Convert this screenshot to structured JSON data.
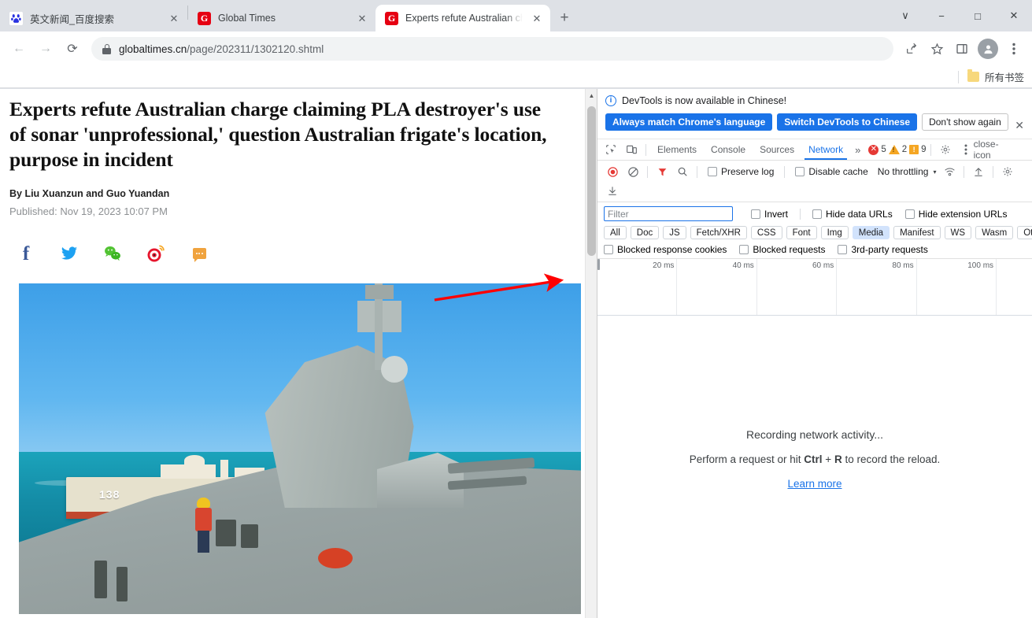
{
  "browser": {
    "tabs": [
      {
        "title": "英文新闻_百度搜索",
        "favicon": "baidu-icon",
        "active": false
      },
      {
        "title": "Global Times",
        "favicon": "globaltimes-icon",
        "active": false
      },
      {
        "title": "Experts refute Australian charge claiming PLA destroyer's use of sonar",
        "favicon": "globaltimes-icon",
        "active": true
      }
    ],
    "new_tab_label": "+",
    "window_controls": {
      "minimize": "−",
      "maximize": "□",
      "close": "✕",
      "chevron": "∨"
    },
    "nav": {
      "back": "←",
      "forward": "→",
      "reload": "⟳"
    },
    "omnibox": {
      "host": "globaltimes.cn",
      "path": "/page/202311/1302120.shtml",
      "lock_icon": "lock-icon"
    },
    "toolbar_icons": [
      "share-icon",
      "bookmark-star-icon",
      "side-panel-icon",
      "profile-avatar-icon",
      "three-dot-menu-icon"
    ],
    "bookmarks": {
      "all_bookmarks_label": "所有书签",
      "folder_icon": "folder-icon"
    }
  },
  "page": {
    "headline": "Experts refute Australian charge claiming PLA destroyer's use of sonar 'unprofessional,' question Australian frigate's location, purpose in incident",
    "byline": "By Liu Xuanzun and Guo Yuandan",
    "published": "Published: Nov 19, 2023 10:07 PM",
    "social": [
      {
        "name": "facebook-icon",
        "color": "#3b5998"
      },
      {
        "name": "twitter-icon",
        "color": "#1da1f2"
      },
      {
        "name": "wechat-icon",
        "color": "#51c332"
      },
      {
        "name": "weibo-icon",
        "color": "#e6162d"
      },
      {
        "name": "sms-icon",
        "color": "#f0a33e"
      }
    ],
    "photo": {
      "alt": "PLA Navy destroyer and frigate at sea",
      "hull_number": "138"
    },
    "annotation": {
      "type": "red-arrow",
      "color": "#ff0000"
    }
  },
  "devtools": {
    "notification": {
      "message": "DevTools is now available in Chinese!",
      "buttons": [
        {
          "label": "Always match Chrome's language",
          "style": "primary"
        },
        {
          "label": "Switch DevTools to Chinese",
          "style": "primary"
        },
        {
          "label": "Don't show again",
          "style": "ghost"
        }
      ],
      "close_label": "✕"
    },
    "panels": {
      "inspect_icon": "inspect-element-icon",
      "device_icon": "device-toolbar-icon",
      "tabs": [
        {
          "label": "Elements",
          "active": false
        },
        {
          "label": "Console",
          "active": false
        },
        {
          "label": "Sources",
          "active": false
        },
        {
          "label": "Network",
          "active": true
        }
      ],
      "more_label": "»",
      "counts": {
        "errors": "5",
        "warnings": "2",
        "issues": "9"
      },
      "settings_icon": "gear-icon",
      "menu_icon": "three-dot-menu-icon",
      "close_icon": "close-icon"
    },
    "network_toolbar": {
      "record_icon": "record-stop-icon",
      "clear_icon": "clear-icon",
      "filter_icon": "filter-funnel-icon",
      "search_icon": "search-icon",
      "preserve_log": "Preserve log",
      "disable_cache": "Disable cache",
      "throttling": "No throttling",
      "throttling_caret": "▾",
      "wifi_icon": "network-conditions-icon",
      "import_icon": "import-har-icon",
      "settings_icon": "gear-icon",
      "export_icon": "export-har-icon"
    },
    "filter_bar": {
      "filter_placeholder": "Filter",
      "filter_value": "",
      "invert": "Invert",
      "hide_data_urls": "Hide data URLs",
      "hide_extension_urls": "Hide extension URLs",
      "types": [
        {
          "label": "All",
          "active": false
        },
        {
          "label": "Doc",
          "active": false
        },
        {
          "label": "JS",
          "active": false
        },
        {
          "label": "Fetch/XHR",
          "active": false
        },
        {
          "label": "CSS",
          "active": false
        },
        {
          "label": "Font",
          "active": false
        },
        {
          "label": "Img",
          "active": false
        },
        {
          "label": "Media",
          "active": true
        },
        {
          "label": "Manifest",
          "active": false
        },
        {
          "label": "WS",
          "active": false
        },
        {
          "label": "Wasm",
          "active": false
        },
        {
          "label": "Other",
          "active": false
        }
      ],
      "blocked_response_cookies": "Blocked response cookies",
      "blocked_requests": "Blocked requests",
      "third_party_requests": "3rd-party requests"
    },
    "overview": {
      "ticks": [
        "20 ms",
        "40 ms",
        "60 ms",
        "80 ms",
        "100 ms"
      ]
    },
    "empty_state": {
      "title": "Recording network activity...",
      "hint_prefix": "Perform a request or hit ",
      "hint_key1": "Ctrl",
      "hint_plus": " + ",
      "hint_key2": "R",
      "hint_suffix": " to record the reload.",
      "learn_more": "Learn more"
    }
  }
}
